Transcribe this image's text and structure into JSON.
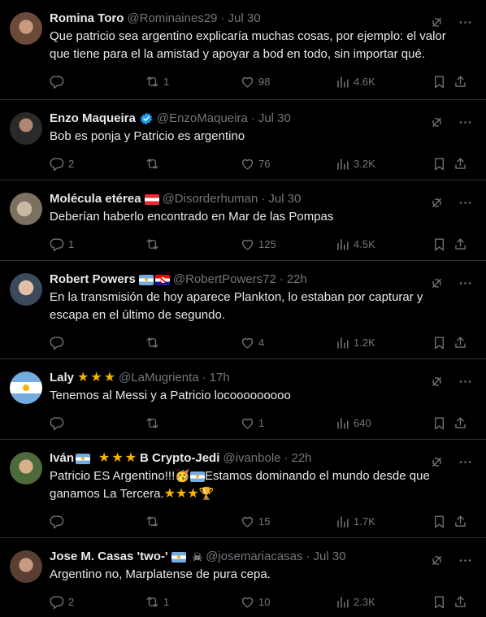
{
  "tweets": [
    {
      "name": "Romina Toro",
      "handle": "@Rominaines29",
      "time": "Jul 30",
      "text": "Que patricio sea argentino explicaría muchas cosas, por ejemplo: el valor que tiene para el la amistad y apoyar a bod en todo, sin importar qué.",
      "replies": "",
      "retweets": "1",
      "likes": "98",
      "views": "4.6K"
    },
    {
      "name": "Enzo Maqueira",
      "handle": "@EnzoMaqueira",
      "time": "Jul 30",
      "text": "Bob es ponja y Patricio es argentino",
      "replies": "2",
      "retweets": "",
      "likes": "76",
      "views": "3.2K"
    },
    {
      "name": "Molécula etérea",
      "handle": "@Disorderhuman",
      "time": "Jul 30",
      "text": "Deberían haberlo encontrado en Mar de las Pompas",
      "replies": "1",
      "retweets": "",
      "likes": "125",
      "views": "4.5K"
    },
    {
      "name": "Robert Powers",
      "handle": "@RobertPowers72",
      "time": "22h",
      "text": "En la transmisión de hoy aparece Plankton, lo estaban por capturar y escapa en el último de segundo.",
      "replies": "",
      "retweets": "",
      "likes": "4",
      "views": "1.2K"
    },
    {
      "name": "Laly",
      "handle": "@LaMugrienta",
      "time": "17h",
      "text": "Tenemos al Messi y a Patricio locooooooooo",
      "replies": "",
      "retweets": "",
      "likes": "1",
      "views": "640"
    },
    {
      "name": "Iván",
      "name_suffix": "B Crypto-Jedi",
      "handle": "@ivanbole",
      "time": "22h",
      "text_part1": "Patricio ES Argentino!!!",
      "text_part2": "Estamos dominando el mundo desde que ganamos La Tercera.",
      "replies": "",
      "retweets": "",
      "likes": "15",
      "views": "1.7K"
    },
    {
      "name": "Jose M. Casas 'two-'",
      "handle": "@josemariacasas",
      "time": "Jul 30",
      "text": "Argentino no, Marplatense de pura cepa.",
      "replies": "2",
      "retweets": "1",
      "likes": "10",
      "views": "2.3K"
    }
  ],
  "separator": "·",
  "colors": {
    "background": "#000000",
    "text": "#e7e9ea",
    "muted": "#71767b",
    "border": "#2f3336",
    "verified": "#1d9bf0"
  },
  "icons": [
    "grok-icon",
    "more-icon",
    "reply-icon",
    "retweet-icon",
    "like-icon",
    "views-icon",
    "bookmark-icon",
    "share-icon",
    "verified-badge-icon"
  ]
}
